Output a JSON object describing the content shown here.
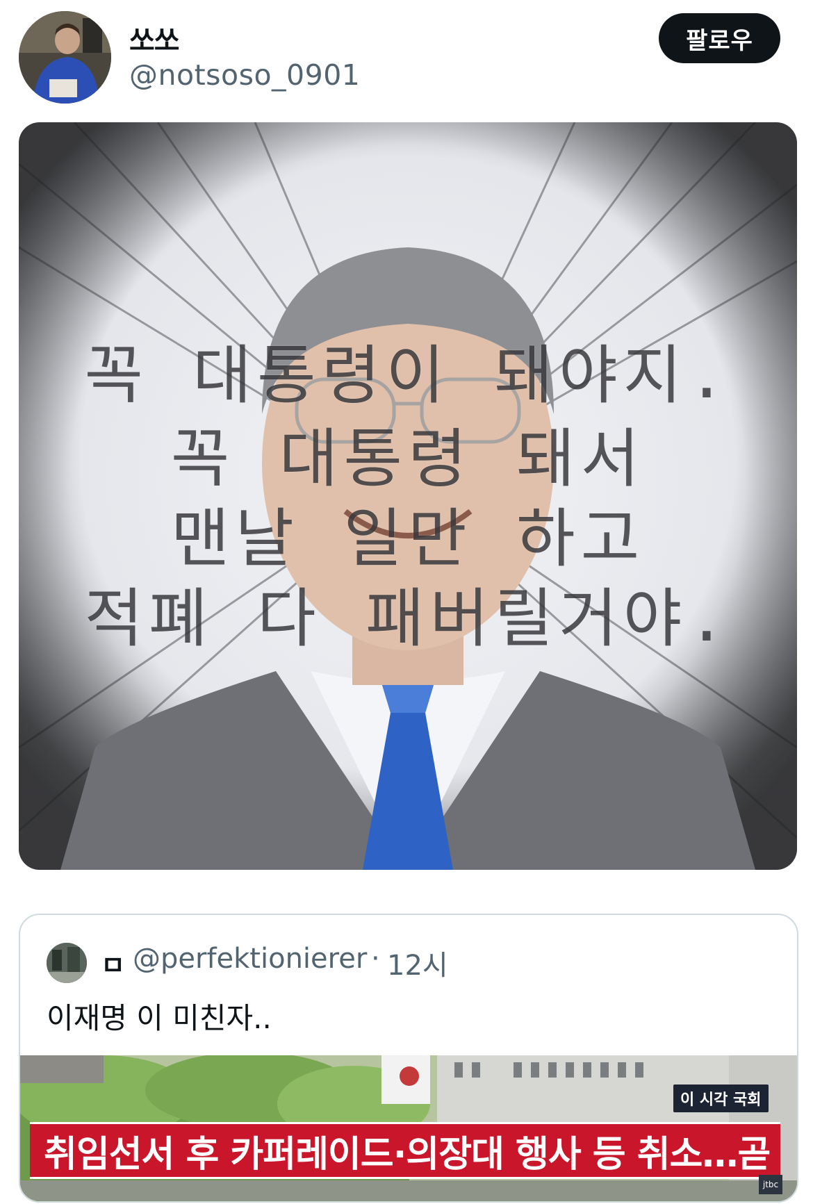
{
  "tweet": {
    "author": {
      "display_name": "쏘쏘",
      "handle": "@notsoso_0901"
    },
    "follow_label": "팔로우",
    "image": {
      "overlay_lines": [
        "꼭 대통령이 돼야지.",
        "꼭 대통령 돼서",
        "맨날 일만 하고",
        "적폐 다 패버릴거야."
      ]
    }
  },
  "quoted_tweet": {
    "author": {
      "display_name": "ㅁ",
      "handle": "@perfektionierer"
    },
    "separator": "·",
    "time": "12시",
    "text": "이재명 이 미친자..",
    "thumbnail": {
      "tag": "이 시각 국회",
      "headline": "취임선서 후 카퍼레이드·의장대 행사 등 취소…곧 업무",
      "logo": "jtbc"
    }
  },
  "colors": {
    "follow_bg": "#0f1419",
    "handle": "#536471",
    "card_border": "#cfd9de",
    "banner_red": "#c9162b"
  }
}
